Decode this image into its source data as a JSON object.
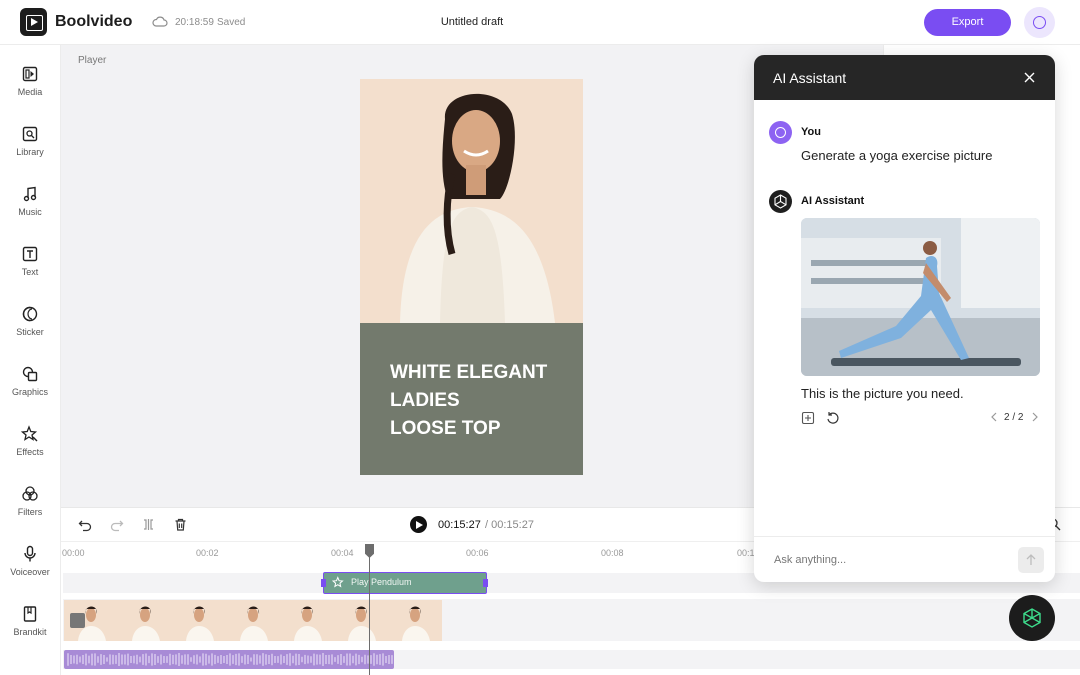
{
  "header": {
    "app_name": "Boolvideo",
    "save_time": "20:18:59",
    "save_status": "Saved",
    "draft_title": "Untitled draft",
    "export_label": "Export",
    "accent_color": "#7a4df2"
  },
  "sidebar": {
    "items": [
      {
        "label": "Media",
        "icon": "media-icon"
      },
      {
        "label": "Library",
        "icon": "library-icon"
      },
      {
        "label": "Music",
        "icon": "music-icon"
      },
      {
        "label": "Text",
        "icon": "text-icon"
      },
      {
        "label": "Sticker",
        "icon": "sticker-icon"
      },
      {
        "label": "Graphics",
        "icon": "graphics-icon"
      },
      {
        "label": "Effects",
        "icon": "effects-icon"
      },
      {
        "label": "Filters",
        "icon": "filters-icon"
      },
      {
        "label": "Voiceover",
        "icon": "voiceover-icon"
      },
      {
        "label": "Brandkit",
        "icon": "brandkit-icon"
      }
    ]
  },
  "player": {
    "label": "Player",
    "caption_lines": [
      "WHITE ELEGANT",
      "LADIES",
      "LOOSE TOP"
    ],
    "panel_color": "#737a6d"
  },
  "timeline": {
    "current_time": "00:15:27",
    "total_time": "/ 00:15:27",
    "ruler_labels": [
      "00:00",
      "00:02",
      "00:04",
      "00:06",
      "00:08",
      "00:1"
    ],
    "effect_clip_label": "Play Pendulum"
  },
  "ai_assistant": {
    "title": "AI Assistant",
    "messages": [
      {
        "author": "You",
        "text": "Generate a yoga exercise picture"
      },
      {
        "author": "AI Assistant",
        "text": "This is the picture you need."
      }
    ],
    "pager": "2 / 2",
    "input_placeholder": "Ask anything..."
  }
}
